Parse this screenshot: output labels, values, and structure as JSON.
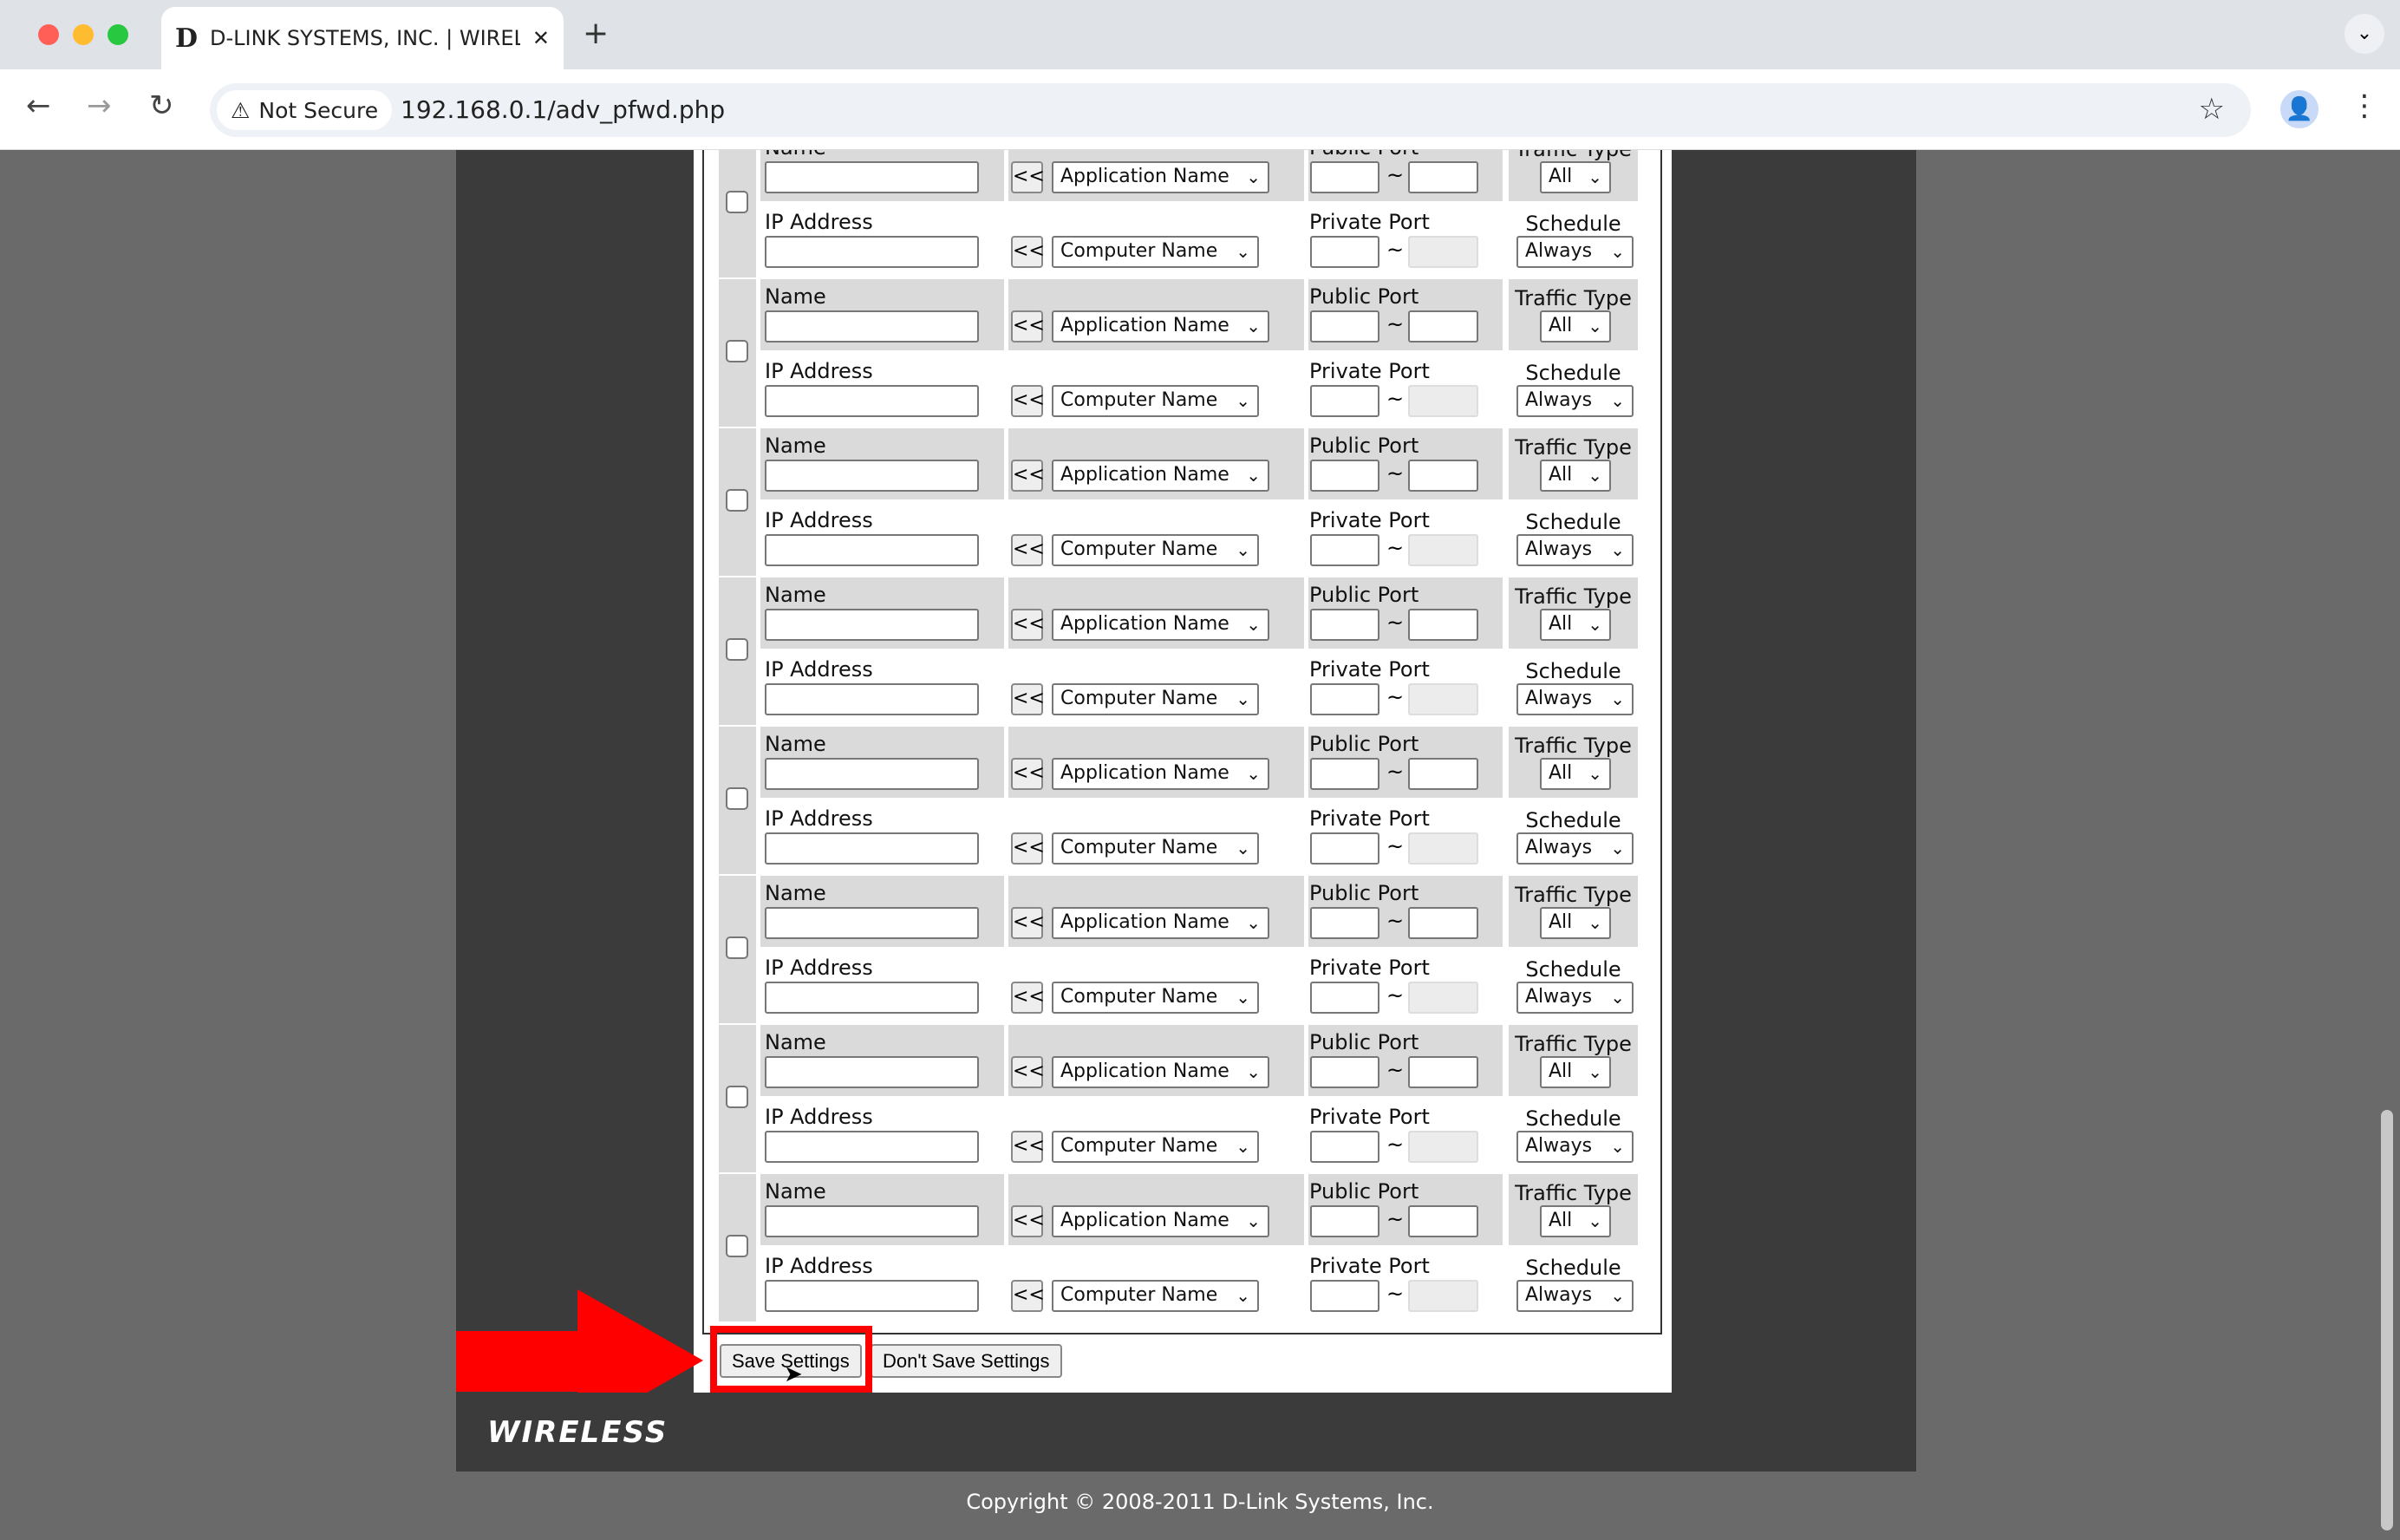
{
  "browser": {
    "tab_title": "D-LINK SYSTEMS, INC. | WIRELESS",
    "tab_favicon": "D",
    "security_label": "Not Secure",
    "url": "192.168.0.1/adv_pfwd.php",
    "colors": {
      "close": "#ff5f57",
      "minimize": "#febc2e",
      "maximize": "#28c840"
    }
  },
  "labels": {
    "name": "Name",
    "ip": "IP Address",
    "public_port": "Public Port",
    "private_port": "Private Port",
    "traffic_type": "Traffic Type",
    "schedule": "Schedule",
    "copy_button": "<<",
    "tilde": "~"
  },
  "entries": [
    {
      "checked": false,
      "name": "",
      "ip": "",
      "application": "Application Name",
      "computer": "Computer Name",
      "public_start": "",
      "public_end": "",
      "private_port": "",
      "traffic_type": "All",
      "schedule": "Always"
    },
    {
      "checked": false,
      "name": "",
      "ip": "",
      "application": "Application Name",
      "computer": "Computer Name",
      "public_start": "",
      "public_end": "",
      "private_port": "",
      "traffic_type": "All",
      "schedule": "Always"
    },
    {
      "checked": false,
      "name": "",
      "ip": "",
      "application": "Application Name",
      "computer": "Computer Name",
      "public_start": "",
      "public_end": "",
      "private_port": "",
      "traffic_type": "All",
      "schedule": "Always"
    },
    {
      "checked": false,
      "name": "",
      "ip": "",
      "application": "Application Name",
      "computer": "Computer Name",
      "public_start": "",
      "public_end": "",
      "private_port": "",
      "traffic_type": "All",
      "schedule": "Always"
    },
    {
      "checked": false,
      "name": "",
      "ip": "",
      "application": "Application Name",
      "computer": "Computer Name",
      "public_start": "",
      "public_end": "",
      "private_port": "",
      "traffic_type": "All",
      "schedule": "Always"
    },
    {
      "checked": false,
      "name": "",
      "ip": "",
      "application": "Application Name",
      "computer": "Computer Name",
      "public_start": "",
      "public_end": "",
      "private_port": "",
      "traffic_type": "All",
      "schedule": "Always"
    },
    {
      "checked": false,
      "name": "",
      "ip": "",
      "application": "Application Name",
      "computer": "Computer Name",
      "public_start": "",
      "public_end": "",
      "private_port": "",
      "traffic_type": "All",
      "schedule": "Always"
    },
    {
      "checked": false,
      "name": "",
      "ip": "",
      "application": "Application Name",
      "computer": "Computer Name",
      "public_start": "",
      "public_end": "",
      "private_port": "",
      "traffic_type": "All",
      "schedule": "Always"
    }
  ],
  "footer": {
    "save_label": "Save Settings",
    "dont_save_label": "Don't Save Settings",
    "brand": "WIRELESS",
    "copyright": "Copyright © 2008-2011 D-Link Systems, Inc."
  },
  "annotation": {
    "color": "#ff0000",
    "highlight": "save-settings-button"
  }
}
